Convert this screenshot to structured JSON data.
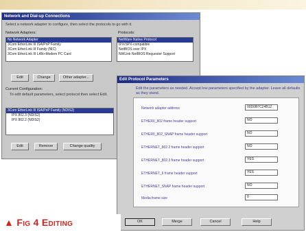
{
  "main_window": {
    "title": "Network and Dial-up Connections",
    "intro_text": "Select a network adapter to configure, then select the protocols to go with it.",
    "adapters_label": "Network Adapters:",
    "protocols_label": "Protocols:",
    "adapters": [
      "No Network Adapter",
      "3Com EtherLink III ISA/PnP Family",
      "3Com EtherLink III Family (NIC)",
      "3Com EtherLink III LAN+Modem PC Card"
    ],
    "protocols": [
      "NetWare Native Protocol",
      "IPX/SPX-compatible",
      "NetBIOS over IPX",
      "NWLink NetBIOS Requester Support"
    ],
    "edit_button": "Edit",
    "change_button": "Change",
    "other_adapter_button": "Other adapter...",
    "config_label": "Current Configuration:",
    "config_hint": "To edit default parameters, select protocol then select Edit.",
    "config_rows": [
      "3Com EtherLink III ISA/PnP Family (NDIS2)",
      "IPX 802.3 (NDIS2)",
      "IPX 802.2 (NDIS2)"
    ],
    "edit_button2": "Edit",
    "remove_button": "Remove",
    "change_quality_button": "Change quality"
  },
  "dialog": {
    "title": "Edit Protocol Parameters",
    "intro_text": "Edit the parameters as needed. Accept low parameters specified by the adapter. Leave all defaults as they stand.",
    "params": [
      {
        "label": "Network adapter address",
        "value": "00D0B7C24B12"
      },
      {
        "label": "ETHERII_802 frame header support",
        "value": "NO"
      },
      {
        "label": "ETHERII_802_SNAP frame header support",
        "value": "NO"
      },
      {
        "label": "ETHERNET_802.2 frame header support",
        "value": "NO"
      },
      {
        "label": "ETHERNET_802.3 frame header support",
        "value": "YES"
      },
      {
        "label": "ETHERNET_II frame header support",
        "value": "YES"
      },
      {
        "label": "ETHERNET_SNAP frame header support",
        "value": "NO"
      },
      {
        "label": "Media frame size",
        "value": "0"
      }
    ],
    "ok_button": "OK",
    "merge_button": "Merge",
    "cancel_button": "Cancel",
    "help_button": "Help"
  },
  "caption": {
    "prefix": "Fig 4",
    "text": "Editing"
  }
}
